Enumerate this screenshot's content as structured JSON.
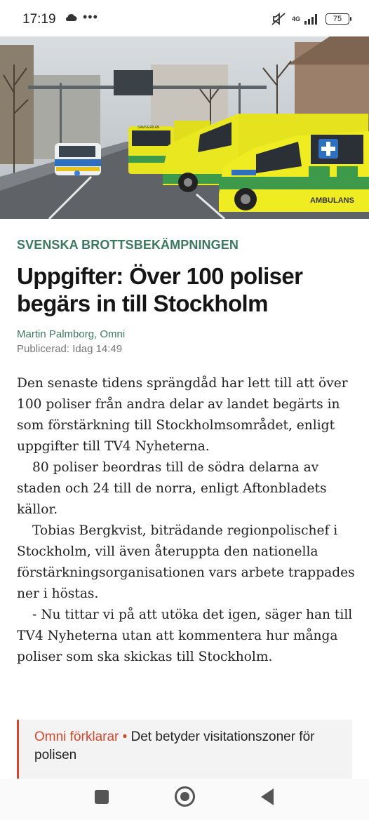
{
  "status_bar": {
    "time": "17:19",
    "dots": "•••",
    "network": "4G",
    "battery": "75"
  },
  "article": {
    "kicker": "SVENSKA BROTTSBEKÄMPNINGEN",
    "headline": "Uppgifter: Över 100 poliser begärs in till Stockholm",
    "author": "Martin Palmborg, Omni",
    "published": "Publicerad: Idag 14:49",
    "paragraphs": [
      "Den senaste tidens sprängdåd har lett till att över 100 poliser från andra delar av landet begärts in som förstärkning till Stockholmsområdet, enligt uppgifter till TV4 Nyheterna.",
      "80 poliser beordras till de södra delarna av staden och 24 till de norra, enligt Aftonbladets källor.",
      "Tobias Bergkvist, biträdande regionpolischef i Stockholm, vill även återuppta den nationella förstärkningsorganisationen vars arbete trappades ner i höstas.",
      "- Nu tittar vi på att utöka det igen, säger han till TV4 Nyheterna utan att kommentera hur många poliser som ska skickas till Stockholm."
    ]
  },
  "photo": {
    "ambulance_label": "AMBULANS",
    "vehicle_label": "SAMVERKAN"
  },
  "explainer": {
    "tag": "Omni förklarar •",
    "title": "Det betyder visitationszoner för polisen"
  },
  "colors": {
    "kicker_green": "#3b7a5f",
    "explainer_red": "#d2472d",
    "ambulance_yellow": "#e7e51e",
    "ambulance_green": "#3d9a4a"
  }
}
